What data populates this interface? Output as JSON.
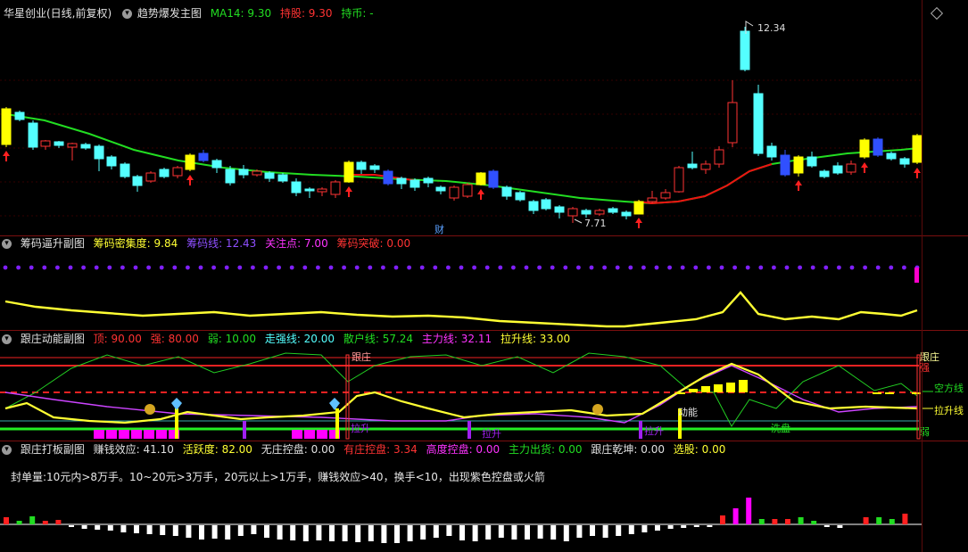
{
  "main_panel": {
    "caret": "▾",
    "symbol": "华星创业(日线,前复权)",
    "indicator_name": "趋势爆发主图",
    "ma_label": "MA14: 9.30",
    "hold_label": "持股: 9.30",
    "coin_label": "持币: -",
    "high_price": "12.34",
    "low_price": "7.71",
    "fin_tag": "财"
  },
  "chip_panel": {
    "name": "筹码逼升副图",
    "density": "筹码密集度: 9.84",
    "chip_line": "筹码线: 12.43",
    "focus": "关注点: 7.00",
    "breakout": "筹码突破: 0.00"
  },
  "follow_panel": {
    "name": "跟庄动能副图",
    "top": "顶: 90.00",
    "strong": "强: 80.00",
    "weak": "弱: 10.00",
    "walk_strong": "走强线: 20.00",
    "retail": "散户线: 57.24",
    "main_force": "主力线: 32.11",
    "pull_up": "拉升线: 33.00",
    "label_follow": "跟庄",
    "label_pull_1": "拉升",
    "label_pull_2": "拉升",
    "label_pull_3": "拉升",
    "label_momentum": "动能",
    "label_rest": "洗盘",
    "right_follow": "跟庄",
    "right_strong": "强",
    "right_empty": "空方线",
    "right_pull": "拉升线",
    "right_weak": "弱"
  },
  "limit_panel": {
    "name": "跟庄打板副图",
    "profit_effect": "赚钱效应: 41.10",
    "activity": "活跃度: 82.00",
    "no_control": "无庄控盘: 0.00",
    "has_control": "有庄控盘: 3.34",
    "high_control": "高度控盘: 0.00",
    "main_out": "主力出货: 0.00",
    "follow_qk": "跟庄乾坤: 0.00",
    "pick": "选股: 0.00",
    "note": "封单量:10元内>8万手。10~20元>3万手，20元以上>1万手，赚钱效应>40，换手<10，出现紫色控盘或火箭"
  },
  "colors": {
    "up": "#ff3333",
    "down": "#54ffff",
    "signal": "#ffff00",
    "ma_green": "#22dd22",
    "ma_red": "#ee1111",
    "yellow_line": "#ffff33",
    "purple": "#a020f0",
    "magenta": "#ff00ff",
    "separator": "#7a0f0f"
  },
  "chart_data": {
    "type": "candlestick",
    "price_high": 12.34,
    "price_low": 7.71
  }
}
